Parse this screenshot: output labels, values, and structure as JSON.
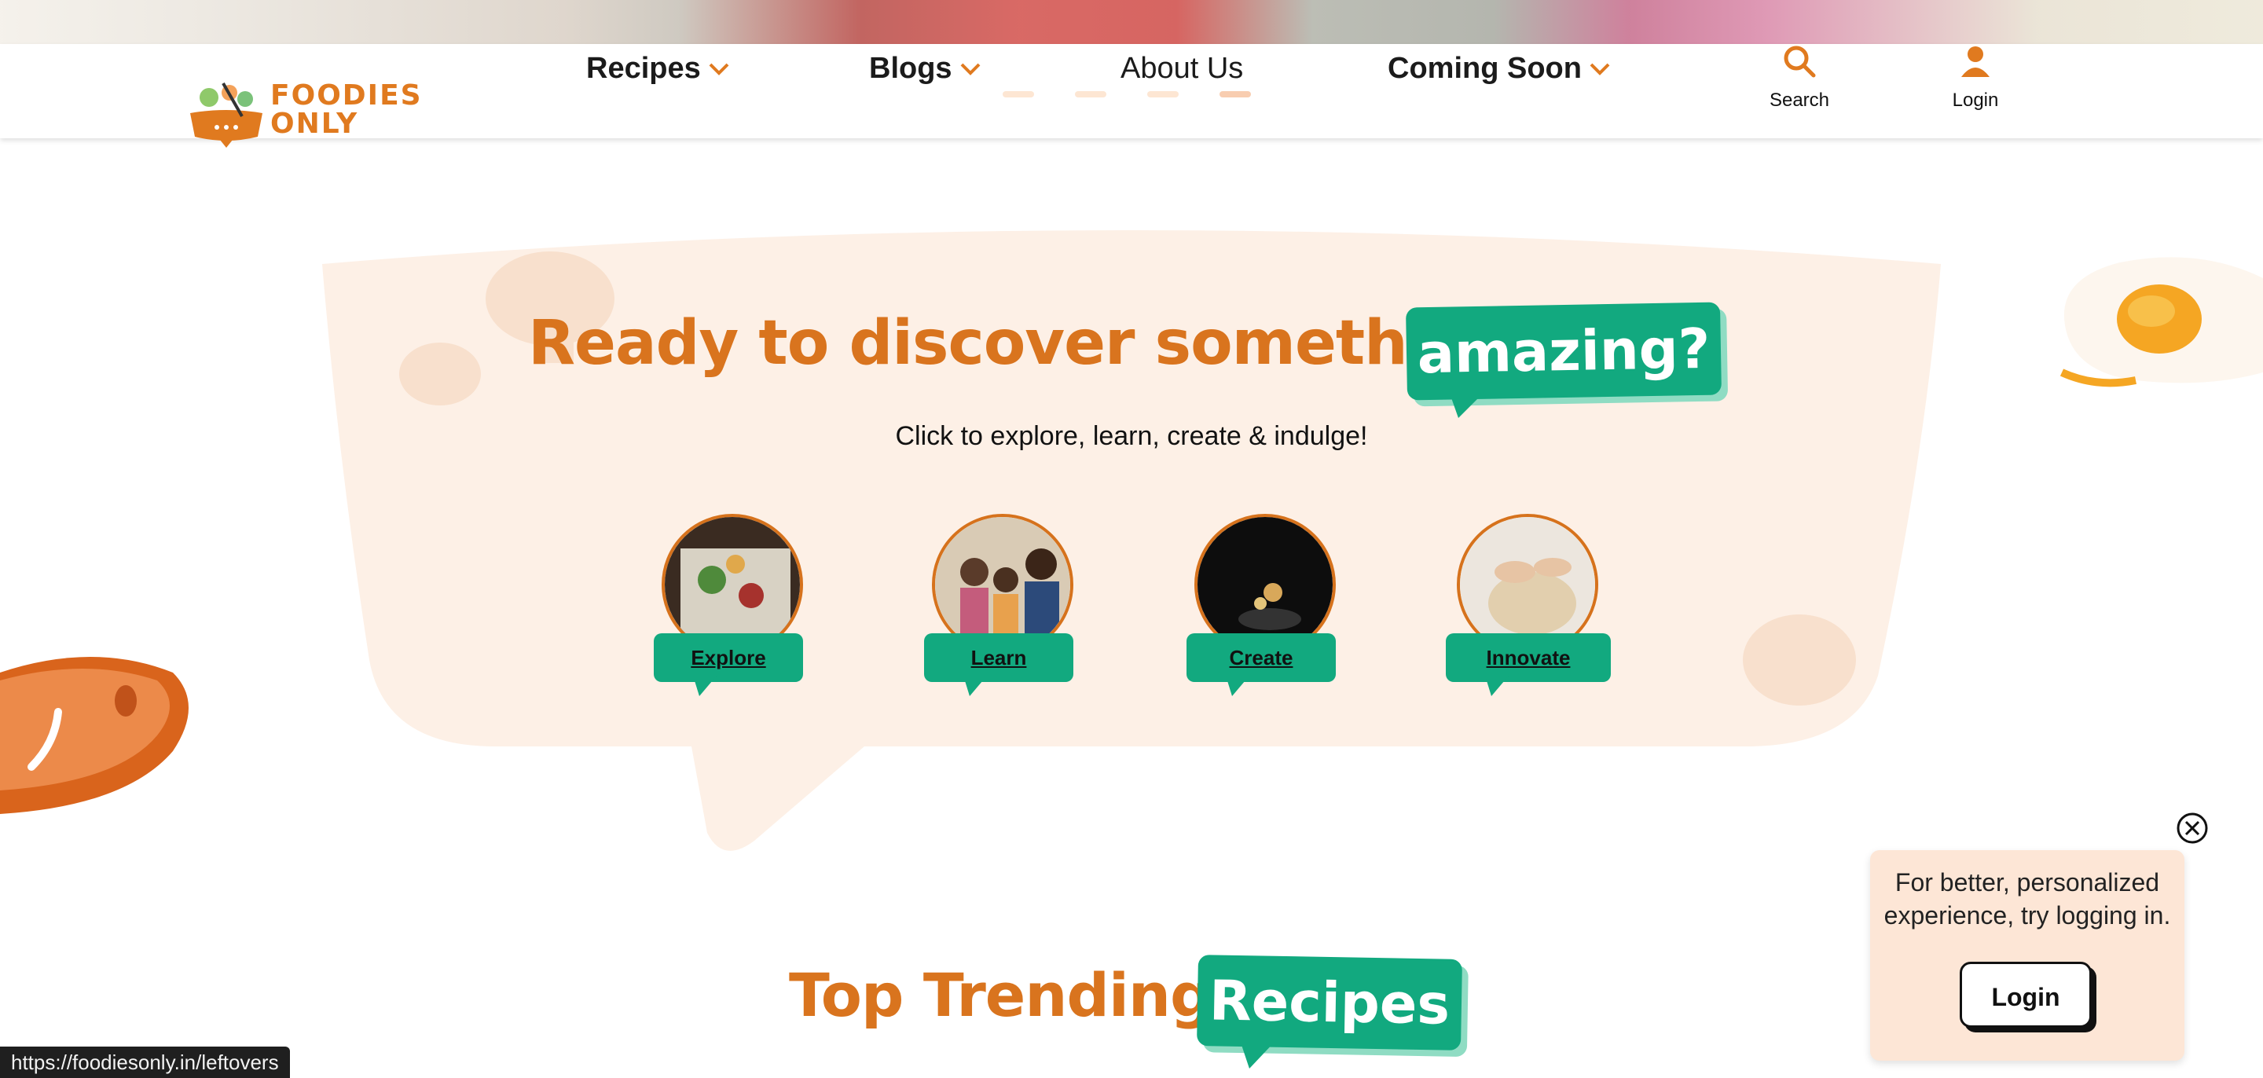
{
  "header": {
    "logo_text_line1": "FOODIES",
    "logo_text_line2": "ONLY",
    "nav": [
      {
        "label": "Recipes",
        "has_dropdown": true
      },
      {
        "label": "Blogs",
        "has_dropdown": true
      },
      {
        "label": "About Us",
        "has_dropdown": false
      },
      {
        "label": "Coming Soon",
        "has_dropdown": true
      }
    ],
    "search_label": "Search",
    "login_label": "Login",
    "slider_dots_count": 4,
    "slider_active_index": 3
  },
  "discover": {
    "headline": "Ready to discover something",
    "tag": "amazing?",
    "subtitle": "Click to explore, learn, create & indulge!",
    "cards": [
      {
        "label": "Explore"
      },
      {
        "label": "Learn"
      },
      {
        "label": "Create"
      },
      {
        "label": "Innovate"
      }
    ]
  },
  "trending": {
    "title": "Top Trending",
    "tag": "Recipes"
  },
  "popup": {
    "message": "For better, personalized experience, try logging in.",
    "button_label": "Login"
  },
  "status_bar": {
    "url": "https://foodiesonly.in/leftovers"
  },
  "colors": {
    "brand_orange": "#d9741e",
    "brand_green": "#12a97f",
    "bubble_bg": "#fdf0e6",
    "popup_bg": "#fde6d6"
  }
}
